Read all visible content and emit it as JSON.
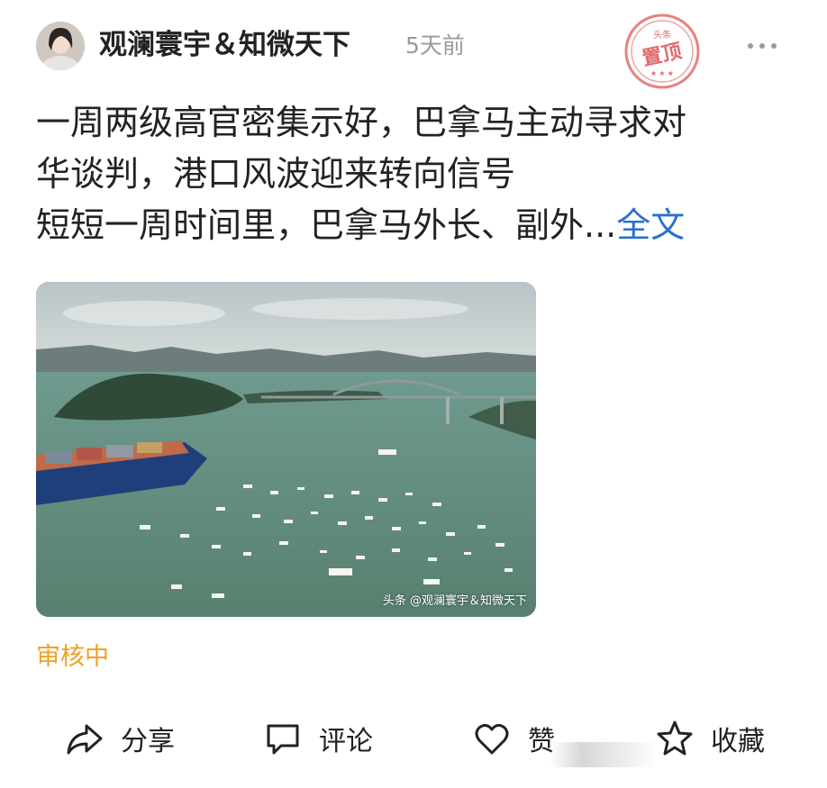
{
  "post": {
    "author": "观澜寰宇＆知微天下",
    "time": "5天前",
    "stamp": {
      "top_text": "头条",
      "main_text": "置顶",
      "color": "#e06c6c"
    },
    "title_line1": "一周两级高官密集示好，巴拿马主动寻求对",
    "title_line2": "华谈判，港口风波迎来转向信号",
    "summary": "短短一周时间里，巴拿马外长、副外...",
    "fulltext_label": "全文",
    "image": {
      "watermark": "头条 @观澜寰宇＆知微天下"
    },
    "review_status": "审核中"
  },
  "actions": {
    "share": {
      "label": "分享",
      "icon": "share-icon"
    },
    "comment": {
      "label": "评论",
      "icon": "comment-icon"
    },
    "like": {
      "label": "赞",
      "icon": "heart-icon"
    },
    "favorite": {
      "label": "收藏",
      "icon": "star-icon"
    }
  },
  "colors": {
    "link": "#2a6fd1",
    "review": "#f0a024",
    "meta": "#9a9a9a",
    "text": "#222222"
  }
}
